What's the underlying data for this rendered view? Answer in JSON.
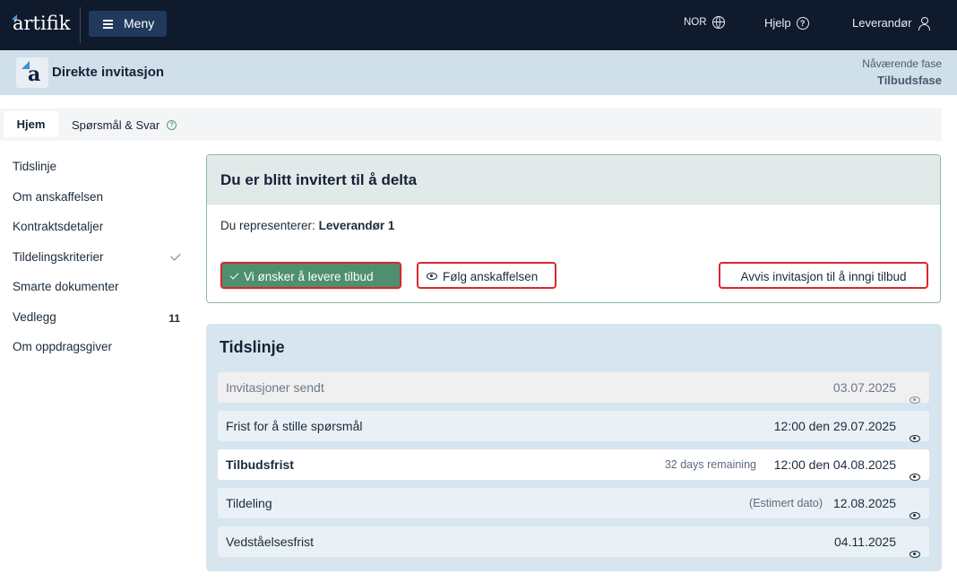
{
  "topbar": {
    "logo_text": "artifik",
    "menu_label": "Meny",
    "language": "NOR",
    "help": "Hjelp",
    "user": "Leverandør"
  },
  "subheader": {
    "title": "Direkte invitasjon",
    "phase_label": "Nåværende fase",
    "phase_value": "Tilbudsfase"
  },
  "tabs": {
    "home": "Hjem",
    "qa": "Spørsmål & Svar"
  },
  "sidenav": {
    "items": [
      {
        "label": "Tidslinje"
      },
      {
        "label": "Om anskaffelsen"
      },
      {
        "label": "Kontraktsdetaljer"
      },
      {
        "label": "Tildelingskriterier",
        "check": true
      },
      {
        "label": "Smarte dokumenter"
      },
      {
        "label": "Vedlegg",
        "count": "11"
      },
      {
        "label": "Om oppdragsgiver"
      }
    ]
  },
  "invite": {
    "title": "Du er blitt invitert til å delta",
    "represent_prefix": "Du representerer:",
    "represent_name": "Leverandør 1",
    "accept_label": "Vi ønsker å levere tilbud",
    "follow_label": "Følg anskaffelsen",
    "reject_label": "Avvis invitasjon til å inngi tilbud"
  },
  "timeline": {
    "title": "Tidslinje",
    "rows": [
      {
        "label": "Invitasjoner sendt",
        "date": "03.07.2025",
        "note": ""
      },
      {
        "label": "Frist for å stille spørsmål",
        "date": "12:00 den 29.07.2025",
        "note": ""
      },
      {
        "label": "Tilbudsfrist",
        "date": "12:00 den 04.08.2025",
        "note": "32 days remaining"
      },
      {
        "label": "Tildeling",
        "date": "12.08.2025",
        "note": "(Estimert dato)"
      },
      {
        "label": "Vedståelsesfrist",
        "date": "04.11.2025",
        "note": ""
      }
    ]
  },
  "colors": {
    "topbar_bg": "#0f1a2d",
    "subheader_bg": "#cfe0ea",
    "primary_green": "#4e8f6f",
    "highlight_red": "#d9272e",
    "timeline_bg": "#d7e5ef"
  }
}
